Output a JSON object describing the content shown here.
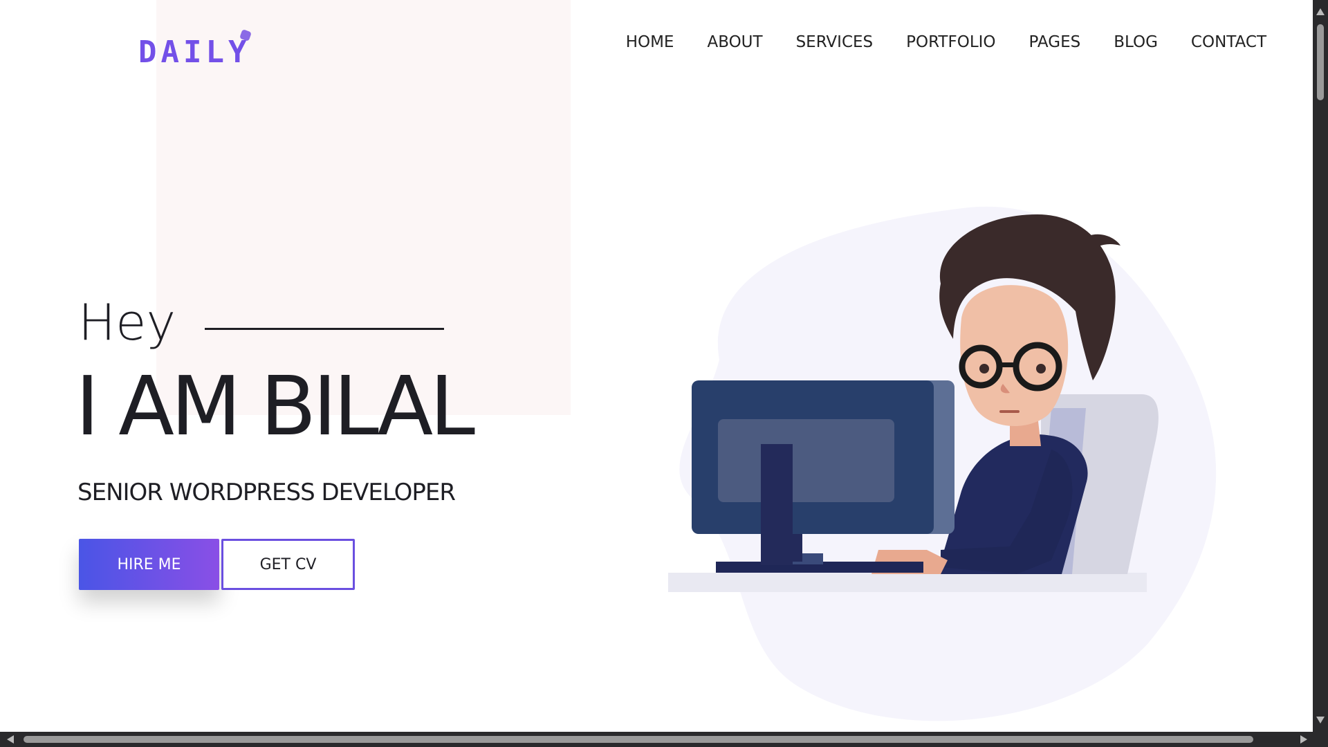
{
  "logo": {
    "text": "DAILY",
    "icon": "pentagon-dot-icon"
  },
  "nav": {
    "items": [
      "HOME",
      "ABOUT",
      "SERVICES",
      "PORTFOLIO",
      "PAGES",
      "BLOG",
      "CONTACT"
    ]
  },
  "hero": {
    "greeting": "Hey",
    "title": "I AM BILAL",
    "subtitle": "SENIOR WORDPRESS DEVELOPER",
    "hire_label": "HIRE ME",
    "cv_label": "GET CV"
  },
  "illustration": {
    "icon": "developer-at-computer-illustration"
  },
  "colors": {
    "accent_start": "#4a55e6",
    "accent_end": "#8a4fe6",
    "logo": "#7350e8",
    "text": "#1e1e24",
    "pink_block": "#fcf6f6",
    "blob": "#f5f4fc"
  }
}
